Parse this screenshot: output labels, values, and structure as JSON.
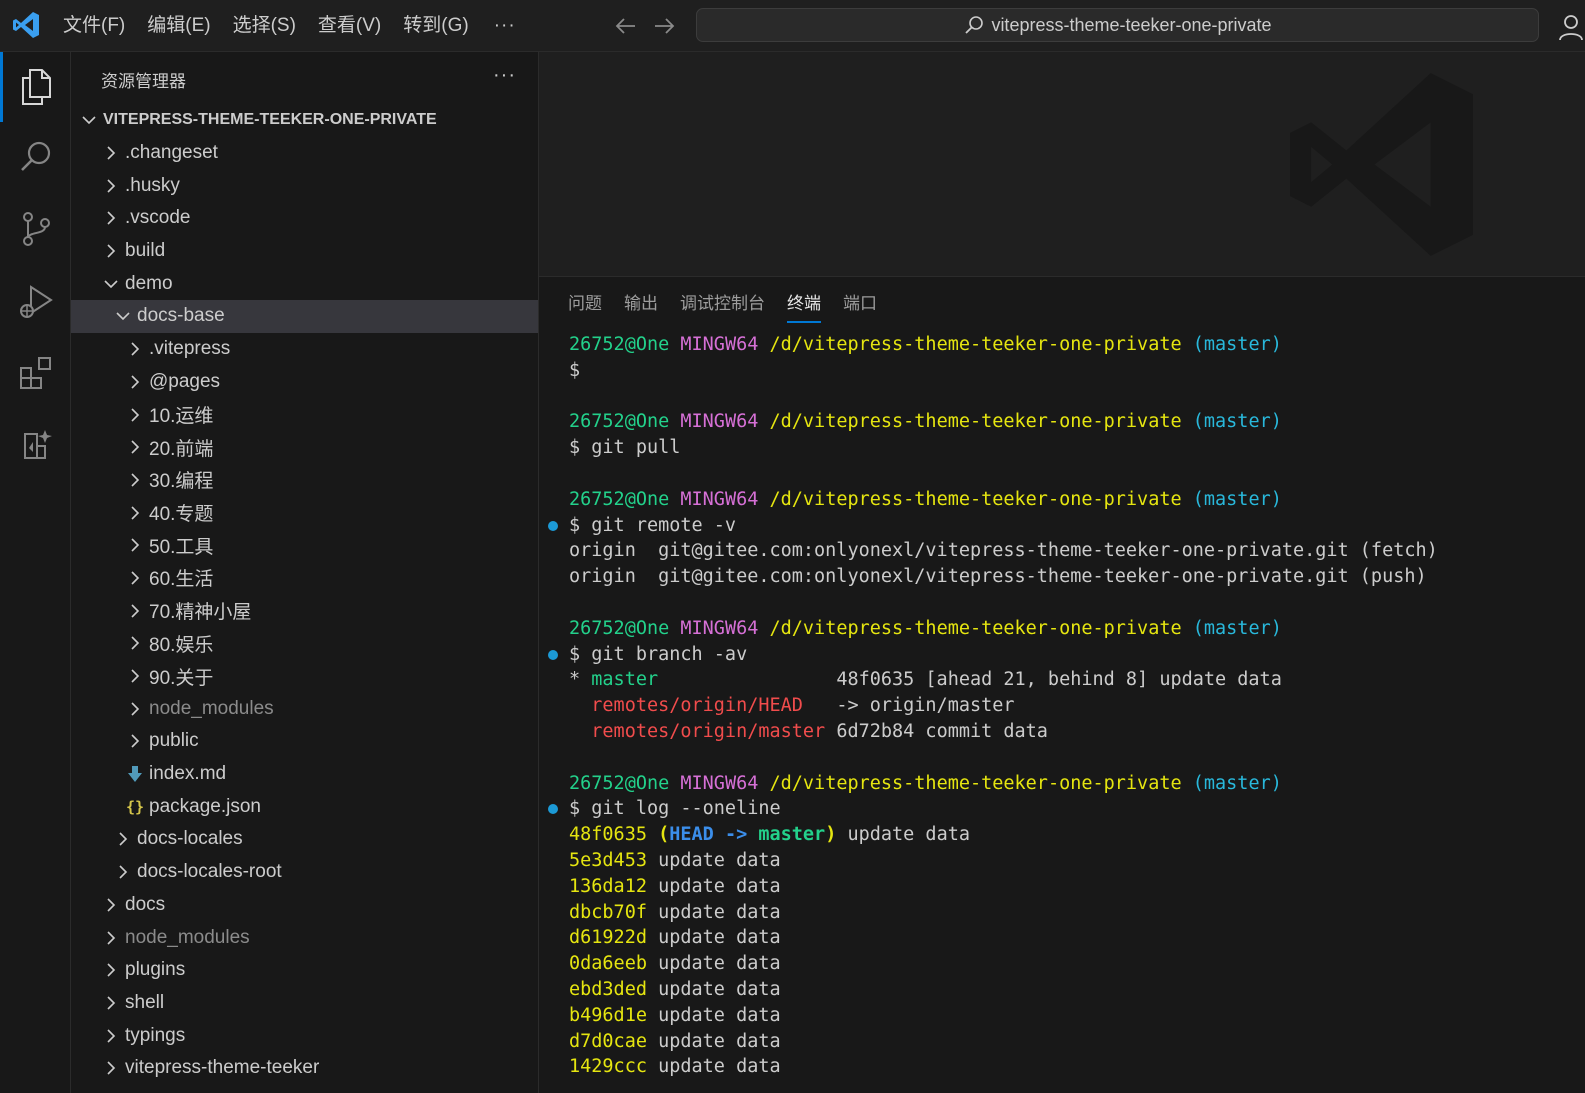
{
  "menu": {
    "items": [
      "文件(F)",
      "编辑(E)",
      "选择(S)",
      "查看(V)",
      "转到(G)"
    ],
    "more": "···"
  },
  "command_center": {
    "text": "vitepress-theme-teeker-one-private"
  },
  "sidebar": {
    "title": "资源管理器",
    "more": "···",
    "tree": [
      {
        "label": "VITEPRESS-THEME-TEEKER-ONE-PRIVATE",
        "depth": 0,
        "type": "root",
        "open": true
      },
      {
        "label": ".changeset",
        "depth": 1,
        "type": "folder",
        "open": false
      },
      {
        "label": ".husky",
        "depth": 1,
        "type": "folder",
        "open": false
      },
      {
        "label": ".vscode",
        "depth": 1,
        "type": "folder",
        "open": false
      },
      {
        "label": "build",
        "depth": 1,
        "type": "folder",
        "open": false
      },
      {
        "label": "demo",
        "depth": 1,
        "type": "folder",
        "open": true
      },
      {
        "label": "docs-base",
        "depth": 2,
        "type": "folder",
        "open": true,
        "selected": true
      },
      {
        "label": ".vitepress",
        "depth": 3,
        "type": "folder",
        "open": false
      },
      {
        "label": "@pages",
        "depth": 3,
        "type": "folder",
        "open": false
      },
      {
        "label": "10.运维",
        "depth": 3,
        "type": "folder",
        "open": false
      },
      {
        "label": "20.前端",
        "depth": 3,
        "type": "folder",
        "open": false
      },
      {
        "label": "30.编程",
        "depth": 3,
        "type": "folder",
        "open": false
      },
      {
        "label": "40.专题",
        "depth": 3,
        "type": "folder",
        "open": false
      },
      {
        "label": "50.工具",
        "depth": 3,
        "type": "folder",
        "open": false
      },
      {
        "label": "60.生活",
        "depth": 3,
        "type": "folder",
        "open": false
      },
      {
        "label": "70.精神小屋",
        "depth": 3,
        "type": "folder",
        "open": false
      },
      {
        "label": "80.娱乐",
        "depth": 3,
        "type": "folder",
        "open": false
      },
      {
        "label": "90.关于",
        "depth": 3,
        "type": "folder",
        "open": false
      },
      {
        "label": "node_modules",
        "depth": 3,
        "type": "folder",
        "open": false,
        "dim": true
      },
      {
        "label": "public",
        "depth": 3,
        "type": "folder",
        "open": false
      },
      {
        "label": "index.md",
        "depth": 3,
        "type": "md"
      },
      {
        "label": "package.json",
        "depth": 3,
        "type": "json"
      },
      {
        "label": "docs-locales",
        "depth": 2,
        "type": "folder",
        "open": false
      },
      {
        "label": "docs-locales-root",
        "depth": 2,
        "type": "folder",
        "open": false
      },
      {
        "label": "docs",
        "depth": 1,
        "type": "folder",
        "open": false
      },
      {
        "label": "node_modules",
        "depth": 1,
        "type": "folder",
        "open": false,
        "dim": true
      },
      {
        "label": "plugins",
        "depth": 1,
        "type": "folder",
        "open": false
      },
      {
        "label": "shell",
        "depth": 1,
        "type": "folder",
        "open": false
      },
      {
        "label": "typings",
        "depth": 1,
        "type": "folder",
        "open": false
      },
      {
        "label": "vitepress-theme-teeker",
        "depth": 1,
        "type": "folder",
        "open": false
      }
    ]
  },
  "panel": {
    "tabs": [
      {
        "label": "问题",
        "active": false
      },
      {
        "label": "输出",
        "active": false
      },
      {
        "label": "调试控制台",
        "active": false
      },
      {
        "label": "终端",
        "active": true
      },
      {
        "label": "端口",
        "active": false
      }
    ]
  },
  "terminal": {
    "lines": [
      {
        "segs": [
          [
            "26752@One",
            "c-green"
          ],
          [
            " ",
            ""
          ],
          [
            "MINGW64",
            "c-mag"
          ],
          [
            " ",
            ""
          ],
          [
            "/d/vitepress-theme-teeker-one-private",
            "c-yel"
          ],
          [
            " ",
            ""
          ],
          [
            "(master)",
            "c-cyan"
          ]
        ]
      },
      {
        "segs": [
          [
            "$",
            ""
          ]
        ]
      },
      {
        "segs": []
      },
      {
        "segs": [
          [
            "26752@One",
            "c-green"
          ],
          [
            " ",
            ""
          ],
          [
            "MINGW64",
            "c-mag"
          ],
          [
            " ",
            ""
          ],
          [
            "/d/vitepress-theme-teeker-one-private",
            "c-yel"
          ],
          [
            " ",
            ""
          ],
          [
            "(master)",
            "c-cyan"
          ]
        ]
      },
      {
        "segs": [
          [
            "$ git pull",
            ""
          ]
        ]
      },
      {
        "segs": []
      },
      {
        "segs": [
          [
            "26752@One",
            "c-green"
          ],
          [
            " ",
            ""
          ],
          [
            "MINGW64",
            "c-mag"
          ],
          [
            " ",
            ""
          ],
          [
            "/d/vitepress-theme-teeker-one-private",
            "c-yel"
          ],
          [
            " ",
            ""
          ],
          [
            "(master)",
            "c-cyan"
          ]
        ]
      },
      {
        "mark": true,
        "segs": [
          [
            "$ git remote -v",
            ""
          ]
        ]
      },
      {
        "segs": [
          [
            "origin  git@gitee.com:onlyonexl/vitepress-theme-teeker-one-private.git (fetch)",
            ""
          ]
        ]
      },
      {
        "segs": [
          [
            "origin  git@gitee.com:onlyonexl/vitepress-theme-teeker-one-private.git (push)",
            ""
          ]
        ]
      },
      {
        "segs": []
      },
      {
        "segs": [
          [
            "26752@One",
            "c-green"
          ],
          [
            " ",
            ""
          ],
          [
            "MINGW64",
            "c-mag"
          ],
          [
            " ",
            ""
          ],
          [
            "/d/vitepress-theme-teeker-one-private",
            "c-yel"
          ],
          [
            " ",
            ""
          ],
          [
            "(master)",
            "c-cyan"
          ]
        ]
      },
      {
        "mark": true,
        "segs": [
          [
            "$ git branch -av",
            ""
          ]
        ]
      },
      {
        "segs": [
          [
            "* ",
            ""
          ],
          [
            "master",
            "c-gr"
          ],
          [
            "                48f0635 [ahead 21, behind 8] update data",
            ""
          ]
        ]
      },
      {
        "segs": [
          [
            "  ",
            ""
          ],
          [
            "remotes/origin/HEAD",
            "c-red"
          ],
          [
            "   -> origin/master",
            ""
          ]
        ]
      },
      {
        "segs": [
          [
            "  ",
            ""
          ],
          [
            "remotes/origin/master",
            "c-red"
          ],
          [
            " 6d72b84 commit data",
            ""
          ]
        ]
      },
      {
        "segs": []
      },
      {
        "segs": [
          [
            "26752@One",
            "c-green"
          ],
          [
            " ",
            ""
          ],
          [
            "MINGW64",
            "c-mag"
          ],
          [
            " ",
            ""
          ],
          [
            "/d/vitepress-theme-teeker-one-private",
            "c-yel"
          ],
          [
            " ",
            ""
          ],
          [
            "(master)",
            "c-cyan"
          ]
        ]
      },
      {
        "mark": true,
        "segs": [
          [
            "$ git log --oneline",
            ""
          ]
        ]
      },
      {
        "segs": [
          [
            "48f0635",
            "c-yel"
          ],
          [
            " ",
            ""
          ],
          [
            "(",
            "c-paren"
          ],
          [
            "HEAD -> ",
            "c-blue"
          ],
          [
            "master",
            "c-master"
          ],
          [
            ")",
            "c-paren"
          ],
          [
            " update data",
            ""
          ]
        ]
      },
      {
        "segs": [
          [
            "5e3d453",
            "c-yel"
          ],
          [
            " update data",
            ""
          ]
        ]
      },
      {
        "segs": [
          [
            "136da12",
            "c-yel"
          ],
          [
            " update data",
            ""
          ]
        ]
      },
      {
        "segs": [
          [
            "dbcb70f",
            "c-yel"
          ],
          [
            " update data",
            ""
          ]
        ]
      },
      {
        "segs": [
          [
            "d61922d",
            "c-yel"
          ],
          [
            " update data",
            ""
          ]
        ]
      },
      {
        "segs": [
          [
            "0da6eeb",
            "c-yel"
          ],
          [
            " update data",
            ""
          ]
        ]
      },
      {
        "segs": [
          [
            "ebd3ded",
            "c-yel"
          ],
          [
            " update data",
            ""
          ]
        ]
      },
      {
        "segs": [
          [
            "b496d1e",
            "c-yel"
          ],
          [
            " update data",
            ""
          ]
        ]
      },
      {
        "segs": [
          [
            "d7d0cae",
            "c-yel"
          ],
          [
            " update data",
            ""
          ]
        ]
      },
      {
        "segs": [
          [
            "1429ccc",
            "c-yel"
          ],
          [
            " update data",
            ""
          ]
        ]
      }
    ]
  }
}
